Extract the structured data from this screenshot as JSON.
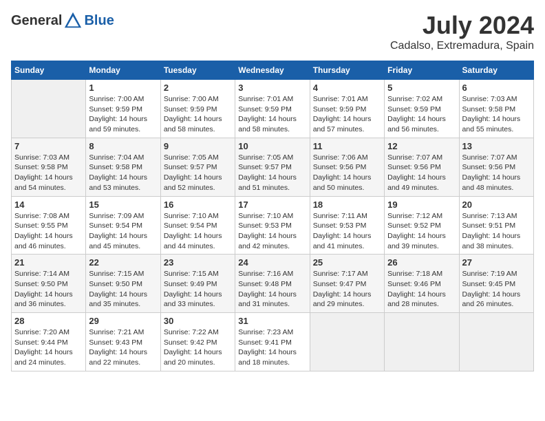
{
  "header": {
    "logo_general": "General",
    "logo_blue": "Blue",
    "month_year": "July 2024",
    "location": "Cadalso, Extremadura, Spain"
  },
  "weekdays": [
    "Sunday",
    "Monday",
    "Tuesday",
    "Wednesday",
    "Thursday",
    "Friday",
    "Saturday"
  ],
  "weeks": [
    [
      {
        "day": "",
        "sunrise": "",
        "sunset": "",
        "daylight": ""
      },
      {
        "day": "1",
        "sunrise": "Sunrise: 7:00 AM",
        "sunset": "Sunset: 9:59 PM",
        "daylight": "Daylight: 14 hours and 59 minutes."
      },
      {
        "day": "2",
        "sunrise": "Sunrise: 7:00 AM",
        "sunset": "Sunset: 9:59 PM",
        "daylight": "Daylight: 14 hours and 58 minutes."
      },
      {
        "day": "3",
        "sunrise": "Sunrise: 7:01 AM",
        "sunset": "Sunset: 9:59 PM",
        "daylight": "Daylight: 14 hours and 58 minutes."
      },
      {
        "day": "4",
        "sunrise": "Sunrise: 7:01 AM",
        "sunset": "Sunset: 9:59 PM",
        "daylight": "Daylight: 14 hours and 57 minutes."
      },
      {
        "day": "5",
        "sunrise": "Sunrise: 7:02 AM",
        "sunset": "Sunset: 9:59 PM",
        "daylight": "Daylight: 14 hours and 56 minutes."
      },
      {
        "day": "6",
        "sunrise": "Sunrise: 7:03 AM",
        "sunset": "Sunset: 9:58 PM",
        "daylight": "Daylight: 14 hours and 55 minutes."
      }
    ],
    [
      {
        "day": "7",
        "sunrise": "Sunrise: 7:03 AM",
        "sunset": "Sunset: 9:58 PM",
        "daylight": "Daylight: 14 hours and 54 minutes."
      },
      {
        "day": "8",
        "sunrise": "Sunrise: 7:04 AM",
        "sunset": "Sunset: 9:58 PM",
        "daylight": "Daylight: 14 hours and 53 minutes."
      },
      {
        "day": "9",
        "sunrise": "Sunrise: 7:05 AM",
        "sunset": "Sunset: 9:57 PM",
        "daylight": "Daylight: 14 hours and 52 minutes."
      },
      {
        "day": "10",
        "sunrise": "Sunrise: 7:05 AM",
        "sunset": "Sunset: 9:57 PM",
        "daylight": "Daylight: 14 hours and 51 minutes."
      },
      {
        "day": "11",
        "sunrise": "Sunrise: 7:06 AM",
        "sunset": "Sunset: 9:56 PM",
        "daylight": "Daylight: 14 hours and 50 minutes."
      },
      {
        "day": "12",
        "sunrise": "Sunrise: 7:07 AM",
        "sunset": "Sunset: 9:56 PM",
        "daylight": "Daylight: 14 hours and 49 minutes."
      },
      {
        "day": "13",
        "sunrise": "Sunrise: 7:07 AM",
        "sunset": "Sunset: 9:56 PM",
        "daylight": "Daylight: 14 hours and 48 minutes."
      }
    ],
    [
      {
        "day": "14",
        "sunrise": "Sunrise: 7:08 AM",
        "sunset": "Sunset: 9:55 PM",
        "daylight": "Daylight: 14 hours and 46 minutes."
      },
      {
        "day": "15",
        "sunrise": "Sunrise: 7:09 AM",
        "sunset": "Sunset: 9:54 PM",
        "daylight": "Daylight: 14 hours and 45 minutes."
      },
      {
        "day": "16",
        "sunrise": "Sunrise: 7:10 AM",
        "sunset": "Sunset: 9:54 PM",
        "daylight": "Daylight: 14 hours and 44 minutes."
      },
      {
        "day": "17",
        "sunrise": "Sunrise: 7:10 AM",
        "sunset": "Sunset: 9:53 PM",
        "daylight": "Daylight: 14 hours and 42 minutes."
      },
      {
        "day": "18",
        "sunrise": "Sunrise: 7:11 AM",
        "sunset": "Sunset: 9:53 PM",
        "daylight": "Daylight: 14 hours and 41 minutes."
      },
      {
        "day": "19",
        "sunrise": "Sunrise: 7:12 AM",
        "sunset": "Sunset: 9:52 PM",
        "daylight": "Daylight: 14 hours and 39 minutes."
      },
      {
        "day": "20",
        "sunrise": "Sunrise: 7:13 AM",
        "sunset": "Sunset: 9:51 PM",
        "daylight": "Daylight: 14 hours and 38 minutes."
      }
    ],
    [
      {
        "day": "21",
        "sunrise": "Sunrise: 7:14 AM",
        "sunset": "Sunset: 9:50 PM",
        "daylight": "Daylight: 14 hours and 36 minutes."
      },
      {
        "day": "22",
        "sunrise": "Sunrise: 7:15 AM",
        "sunset": "Sunset: 9:50 PM",
        "daylight": "Daylight: 14 hours and 35 minutes."
      },
      {
        "day": "23",
        "sunrise": "Sunrise: 7:15 AM",
        "sunset": "Sunset: 9:49 PM",
        "daylight": "Daylight: 14 hours and 33 minutes."
      },
      {
        "day": "24",
        "sunrise": "Sunrise: 7:16 AM",
        "sunset": "Sunset: 9:48 PM",
        "daylight": "Daylight: 14 hours and 31 minutes."
      },
      {
        "day": "25",
        "sunrise": "Sunrise: 7:17 AM",
        "sunset": "Sunset: 9:47 PM",
        "daylight": "Daylight: 14 hours and 29 minutes."
      },
      {
        "day": "26",
        "sunrise": "Sunrise: 7:18 AM",
        "sunset": "Sunset: 9:46 PM",
        "daylight": "Daylight: 14 hours and 28 minutes."
      },
      {
        "day": "27",
        "sunrise": "Sunrise: 7:19 AM",
        "sunset": "Sunset: 9:45 PM",
        "daylight": "Daylight: 14 hours and 26 minutes."
      }
    ],
    [
      {
        "day": "28",
        "sunrise": "Sunrise: 7:20 AM",
        "sunset": "Sunset: 9:44 PM",
        "daylight": "Daylight: 14 hours and 24 minutes."
      },
      {
        "day": "29",
        "sunrise": "Sunrise: 7:21 AM",
        "sunset": "Sunset: 9:43 PM",
        "daylight": "Daylight: 14 hours and 22 minutes."
      },
      {
        "day": "30",
        "sunrise": "Sunrise: 7:22 AM",
        "sunset": "Sunset: 9:42 PM",
        "daylight": "Daylight: 14 hours and 20 minutes."
      },
      {
        "day": "31",
        "sunrise": "Sunrise: 7:23 AM",
        "sunset": "Sunset: 9:41 PM",
        "daylight": "Daylight: 14 hours and 18 minutes."
      },
      {
        "day": "",
        "sunrise": "",
        "sunset": "",
        "daylight": ""
      },
      {
        "day": "",
        "sunrise": "",
        "sunset": "",
        "daylight": ""
      },
      {
        "day": "",
        "sunrise": "",
        "sunset": "",
        "daylight": ""
      }
    ]
  ]
}
